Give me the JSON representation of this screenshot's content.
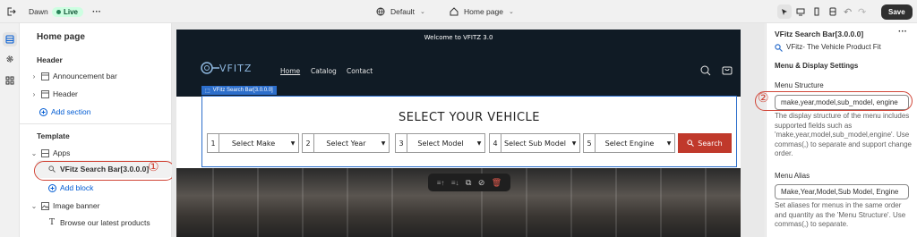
{
  "topbar": {
    "back_icon": "exit-icon",
    "theme_name": "Dawn",
    "live_badge": "Live",
    "more": "···",
    "theme_selector": "Default",
    "page_selector": "Home page",
    "save_label": "Save"
  },
  "left": {
    "title": "Home page",
    "header_section": "Header",
    "announcement_bar": "Announcement bar",
    "header": "Header",
    "add_section": "Add section",
    "template_section": "Template",
    "apps": "Apps",
    "vfitz_block": "VFitz Search Bar[3.0.0.0]",
    "add_block": "Add block",
    "image_banner": "Image banner",
    "browse": "Browse our latest products"
  },
  "annotations": {
    "one": "①",
    "two": "②"
  },
  "store": {
    "announcement": "Welcome to VFITZ 3.0",
    "logo_text": "VFITZ",
    "nav": [
      "Home",
      "Catalog",
      "Contact"
    ],
    "selection_tag": "VFitz Search Bar[3.0.0.0]",
    "select_title": "SELECT YOUR VEHICLE",
    "dropdowns": [
      {
        "num": "1",
        "label": "Select Make"
      },
      {
        "num": "2",
        "label": "Select Year"
      },
      {
        "num": "3",
        "label": "Select Model"
      },
      {
        "num": "4",
        "label": "Select Sub Model"
      },
      {
        "num": "5",
        "label": "Select Engine"
      }
    ],
    "search_label": "Search"
  },
  "right": {
    "title": "VFitz Search Bar[3.0.0.0]",
    "more": "···",
    "app_name": "VFitz- The Vehicle Product Fit",
    "settings_heading": "Menu & Display Settings",
    "structure_label": "Menu Structure",
    "structure_value": "make,year,model,sub_model, engine",
    "structure_help": [
      "The display structure of the menu includes",
      "supported fields such as",
      "'make,year,model,sub_model,engine'. Use",
      "commas(,) to separate and support change",
      "order."
    ],
    "alias_label": "Menu Alias",
    "alias_value": "Make,Year,Model,Sub Model, Engine",
    "alias_help": [
      "Set aliases for menus in the same order",
      "and quantity as the 'Menu Structure'. Use",
      "commas(,) to separate."
    ]
  },
  "colors": {
    "accent_blue": "#2c6ecb",
    "store_dark": "#101b25",
    "search_red": "#c0392b",
    "annotation_red": "#d04436"
  }
}
